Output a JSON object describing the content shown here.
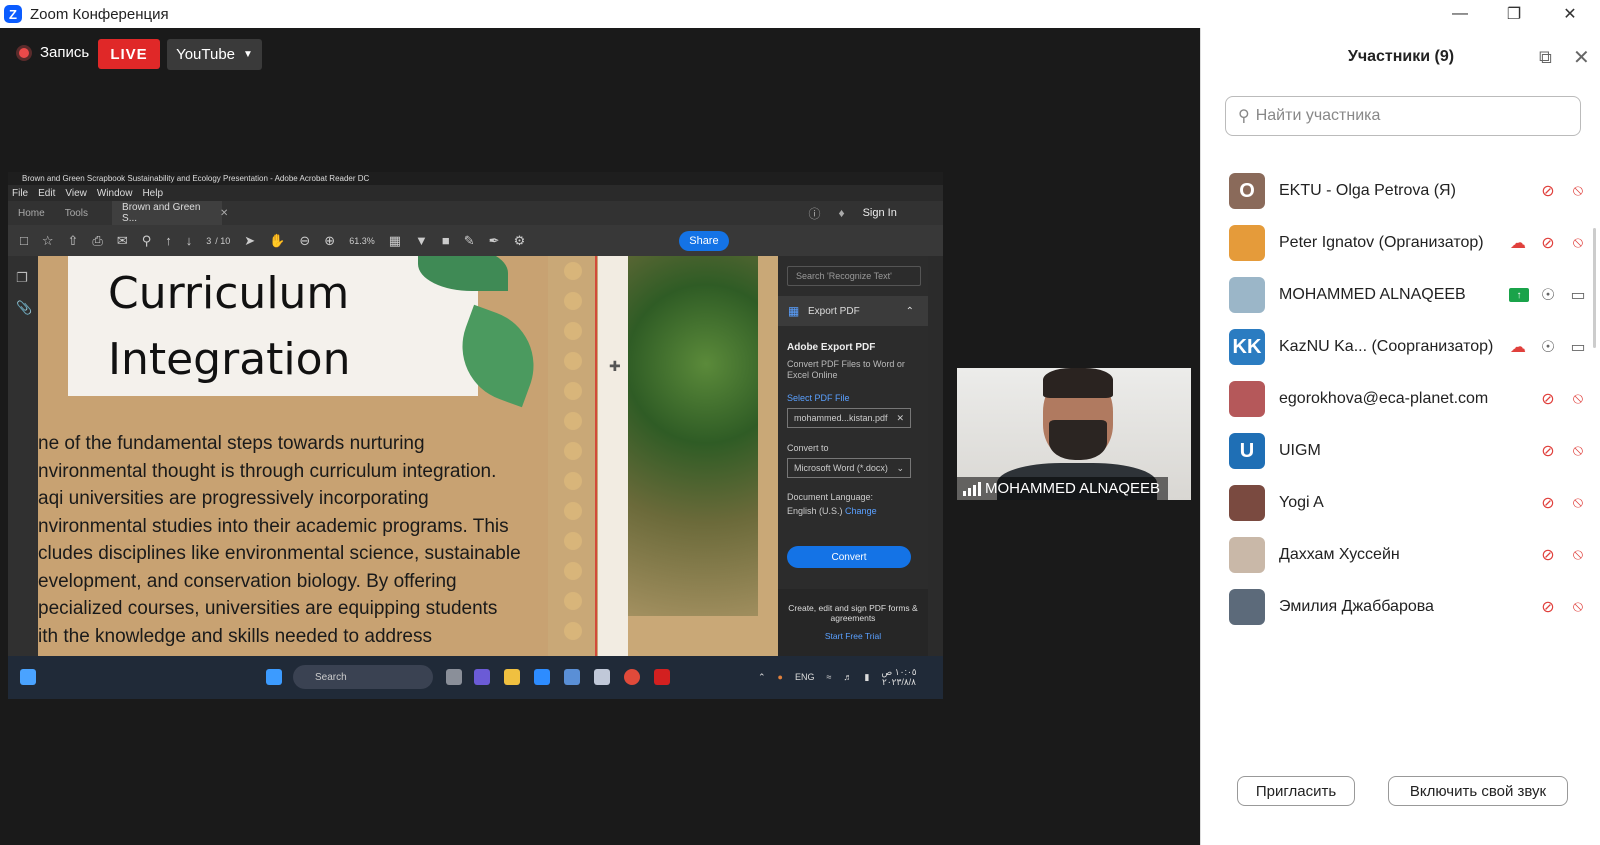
{
  "window": {
    "title": "Zoom Конференция",
    "logo": "Z"
  },
  "recording": {
    "label": "Запись",
    "live": "LIVE",
    "stream": "YouTube",
    "rec_color": "#ec4a4a"
  },
  "shared": {
    "window_title": "Brown and Green Scrapbook Sustainability and Ecology Presentation - Adobe Acrobat Reader DC",
    "menu": [
      "File",
      "Edit",
      "View",
      "Window",
      "Help"
    ],
    "tabs": {
      "home": "Home",
      "tools": "Tools",
      "doc": "Brown and Green S...",
      "sign_in": "Sign In"
    },
    "toolbar": {
      "page": "3",
      "pages": "/ 10",
      "zoom": "61.3%",
      "share": "Share"
    },
    "slide": {
      "heading_line1": "Curriculum",
      "heading_line2": "Integration",
      "body": "ne of the fundamental steps towards nurturing\nnvironmental thought is through curriculum integration.\naqi universities are progressively incorporating\nnvironmental studies into their academic programs. This\ncludes disciplines like environmental science, sustainable\nevelopment, and conservation biology. By offering\npecialized courses, universities are equipping students\nith the knowledge and skills needed to address"
    },
    "panel": {
      "search_placeholder": "Search 'Recognize Text'",
      "export_title": "Export PDF",
      "heading": "Adobe Export PDF",
      "desc": "Convert PDF Files to Word or Excel Online",
      "select_label": "Select PDF File",
      "file_name": "mohammed...kistan.pdf",
      "convert_to_label": "Convert to",
      "format": "Microsoft Word (*.docx)",
      "language_label": "Document Language:",
      "language_value": "English (U.S.)",
      "change": "Change",
      "convert_button": "Convert",
      "promo_text": "Create, edit and sign PDF forms & agreements",
      "trial": "Start Free Trial"
    },
    "taskbar": {
      "search": "Search",
      "lang": "ENG",
      "time": "١٠:٠٥ ص",
      "date": "٢٠٢٣/٨/٨"
    }
  },
  "video": {
    "name": "MOHAMMED ALNAQEEB"
  },
  "participants": {
    "title": "Участники (9)",
    "search_placeholder": "Найти участника",
    "list": [
      {
        "name": "EKTU - Olga Petrova (Я)",
        "initials": "O",
        "color": "#8a6a5a",
        "mic": "muted",
        "cam": "off"
      },
      {
        "name": "Peter Ignatov (Организатор)",
        "initials": "",
        "color": "#e59b3a",
        "mic": "muted",
        "cam": "off",
        "cloud": true
      },
      {
        "name": "MOHAMMED ALNAQEEB",
        "initials": "",
        "color": "#9bb6c8",
        "mic": "on",
        "cam": "on",
        "sharing": true
      },
      {
        "name": "KazNU Ka...  (Соорганизатор)",
        "initials": "KK",
        "color": "#2b7cc1",
        "mic": "on",
        "cam": "on",
        "cloud": true
      },
      {
        "name": "egorokhova@eca-planet.com",
        "initials": "",
        "color": "#b5585a",
        "mic": "muted",
        "cam": "off"
      },
      {
        "name": "UIGM",
        "initials": "U",
        "color": "#1f6fb5",
        "mic": "muted",
        "cam": "off"
      },
      {
        "name": "Yogi A",
        "initials": "",
        "color": "#7a4a40",
        "mic": "muted",
        "cam": "off"
      },
      {
        "name": "Даххам Хуссейн",
        "initials": "",
        "color": "#c9b8a8",
        "mic": "muted",
        "cam": "off"
      },
      {
        "name": "Эмилия Джаббарова",
        "initials": "",
        "color": "#5c6a7a",
        "mic": "muted",
        "cam": "off"
      }
    ],
    "invite": "Пригласить",
    "audio": "Включить свой звук"
  }
}
